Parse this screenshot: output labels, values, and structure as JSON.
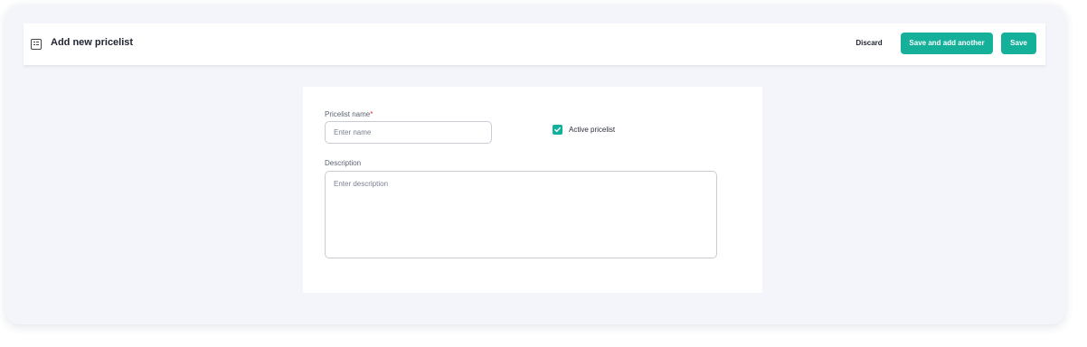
{
  "header": {
    "icon": "pricelist-icon",
    "title": "Add new pricelist",
    "discard_label": "Discard",
    "save_add_another_label": "Save and add another",
    "save_label": "Save"
  },
  "form": {
    "name": {
      "label": "Pricelist name",
      "required_mark": "*",
      "placeholder": "Enter name",
      "value": ""
    },
    "active": {
      "label": "Active pricelist",
      "checked": true
    },
    "description": {
      "label": "Description",
      "placeholder": "Enter description",
      "value": ""
    }
  },
  "colors": {
    "accent": "#14b09a",
    "background": "#f4f5fa",
    "surface": "#ffffff"
  }
}
